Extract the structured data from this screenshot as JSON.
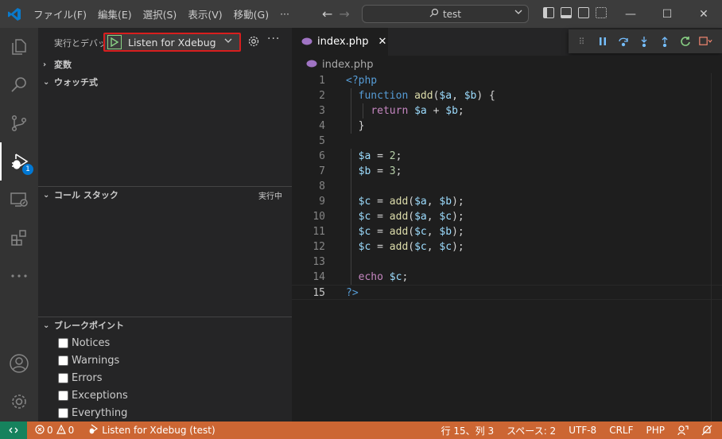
{
  "menu": [
    "ファイル(F)",
    "編集(E)",
    "選択(S)",
    "表示(V)",
    "移動(G)",
    "···"
  ],
  "command_center": {
    "text": "test"
  },
  "activity": {
    "debug_badge": "1"
  },
  "sidebar": {
    "title": "実行とデバッグ",
    "launch_config": "Listen for Xdebug",
    "sections": {
      "variables": "変数",
      "watch": "ウォッチ式",
      "callstack": "コール スタック",
      "callstack_status": "実行中",
      "breakpoints": "ブレークポイント"
    },
    "breakpoints": [
      "Notices",
      "Warnings",
      "Errors",
      "Exceptions",
      "Everything"
    ]
  },
  "editor": {
    "tab_label": "index.php",
    "breadcrumb": "index.php",
    "line_numbers": [
      "1",
      "2",
      "3",
      "4",
      "5",
      "6",
      "7",
      "8",
      "9",
      "10",
      "11",
      "12",
      "13",
      "14",
      "15"
    ],
    "current_line": "15"
  },
  "status": {
    "errors": "0",
    "warnings": "0",
    "debug_session": "Listen for Xdebug (test)",
    "cursor": "行 15、列 3",
    "indent": "スペース: 2",
    "encoding": "UTF-8",
    "eol": "CRLF",
    "language": "PHP"
  },
  "colors": {
    "statusbar": "#cc6633",
    "remote": "#16825d",
    "accent_red_outline": "#d81e1e",
    "play_green": "#89d185",
    "badge_blue": "#0078d4"
  },
  "icons": [
    "vscode-logo-icon",
    "search-icon",
    "back-arrow-icon",
    "forward-arrow-icon",
    "explorer-icon",
    "source-control-icon",
    "run-debug-icon",
    "remote-explorer-icon",
    "extensions-icon",
    "account-icon",
    "manage-gear-icon",
    "play-icon",
    "settings-gear-icon",
    "php-file-icon",
    "pause-icon",
    "step-over-icon",
    "step-into-icon",
    "step-out-icon",
    "restart-icon",
    "stop-icon",
    "remote-icon",
    "error-icon",
    "warning-icon",
    "bell-icon",
    "feedback-icon"
  ]
}
